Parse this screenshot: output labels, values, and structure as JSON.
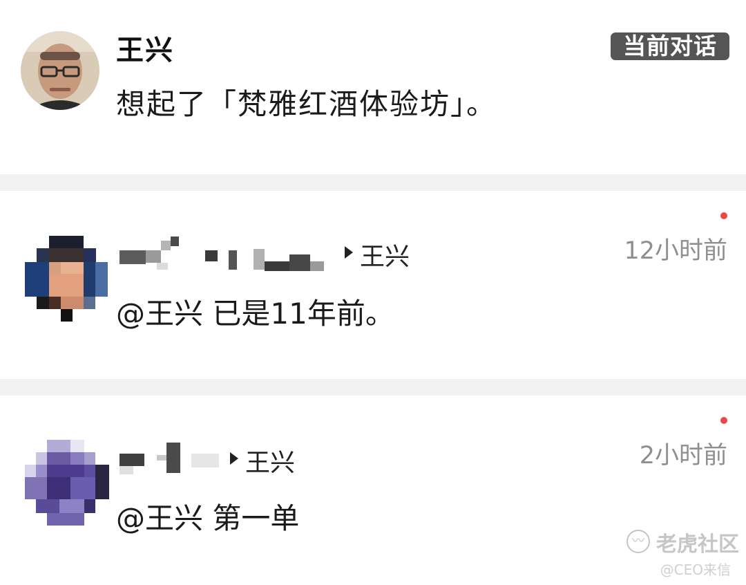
{
  "main_post": {
    "author": "王兴",
    "badge": "当前对话",
    "text": "想起了「梵雅红酒体验坊」。"
  },
  "replies": [
    {
      "reply_to": "王兴",
      "time": "12小时前",
      "mention": "@王兴",
      "text": "已是11年前。",
      "unread": true
    },
    {
      "reply_to": "王兴",
      "time": "2小时前",
      "mention": "@王兴",
      "text": "第一单",
      "unread": true
    }
  ],
  "watermark": {
    "brand": "老虎社区",
    "sub": "@CEO来信"
  },
  "colors": {
    "badge_bg": "#555555",
    "separator": "#f1f1f1",
    "unread_dot": "#e84848",
    "time_text": "#8f8f8f"
  },
  "icons": [
    "arrow-right-icon",
    "tiger-community-logo-icon"
  ]
}
